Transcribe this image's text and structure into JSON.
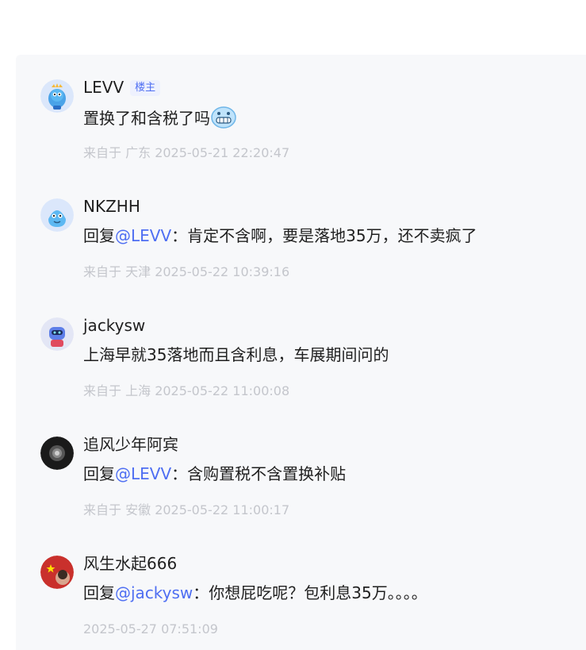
{
  "comments": [
    {
      "name": "LEVV",
      "badge": "楼主",
      "text": "置换了和含税了吗",
      "emoji": "grimace-emoji",
      "meta_prefix": "来自于 广东",
      "time": "2025-05-21 22:20:47",
      "avatar": "blue-mascot-avatar"
    },
    {
      "name": "NKZHH",
      "reply_prefix": "回复",
      "mention": "@LEVV",
      "text": "：肯定不含啊，要是落地35万，还不卖疯了",
      "meta_prefix": "来自于 天津",
      "time": "2025-05-22 10:39:16",
      "avatar": "blue-mascot-avatar"
    },
    {
      "name": "jackysw",
      "text": "上海早就35落地而且含利息，车展期间问的",
      "meta_prefix": "来自于 上海",
      "time": "2025-05-22 11:00:08",
      "avatar": "robot-avatar"
    },
    {
      "name": "追风少年阿宾",
      "reply_prefix": "回复",
      "mention": "@LEVV",
      "text": "：含购置税不含置换补贴",
      "meta_prefix": "来自于 安徽",
      "time": "2025-05-22 11:00:17",
      "avatar": "dark-photo-avatar"
    },
    {
      "name": "风生水起666",
      "reply_prefix": "回复",
      "mention": "@jackysw",
      "text": "：你想屁吃呢？包利息35万。。。。",
      "meta_prefix": "",
      "time": "2025-05-27 07:51:09",
      "avatar": "flag-avatar"
    }
  ],
  "colors": {
    "mention": "#4e6ef2",
    "meta": "#c4c6cc",
    "panel": "#f7f8fa"
  }
}
